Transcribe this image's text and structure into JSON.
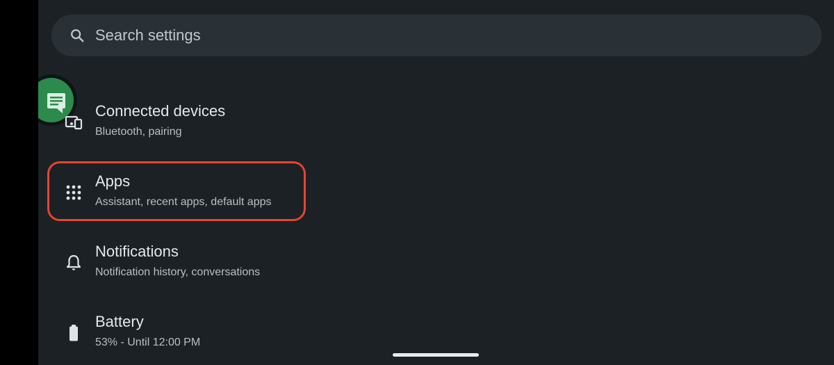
{
  "search": {
    "placeholder": "Search settings"
  },
  "settings": {
    "items": [
      {
        "title": "Connected devices",
        "subtitle": "Bluetooth, pairing",
        "icon": "connected-devices-icon"
      },
      {
        "title": "Apps",
        "subtitle": "Assistant, recent apps, default apps",
        "icon": "apps-grid-icon"
      },
      {
        "title": "Notifications",
        "subtitle": "Notification history, conversations",
        "icon": "bell-icon"
      },
      {
        "title": "Battery",
        "subtitle": "53% - Until 12:00 PM",
        "icon": "battery-icon"
      }
    ]
  },
  "colors": {
    "background": "#1b2125",
    "search_background": "#2a3136",
    "highlight_border": "#e8432f",
    "chat_bubble": "#2c8a4d"
  }
}
